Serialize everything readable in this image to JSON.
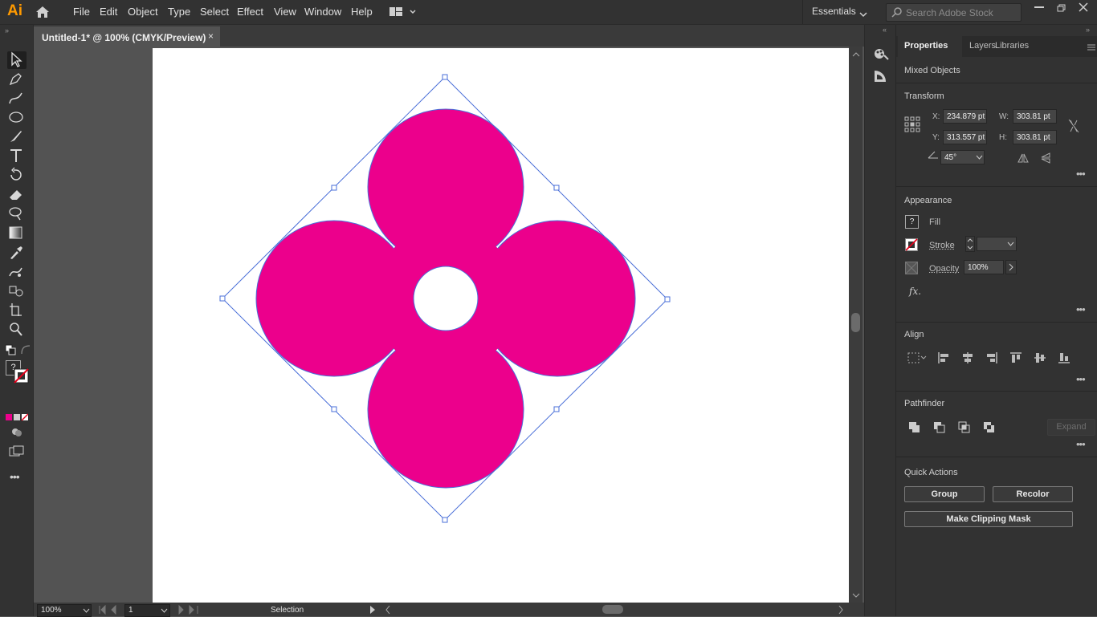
{
  "app": {
    "logo": "Ai"
  },
  "menu": [
    "File",
    "Edit",
    "Object",
    "Type",
    "Select",
    "Effect",
    "View",
    "Window",
    "Help"
  ],
  "workspace": {
    "label": "Essentials"
  },
  "search": {
    "placeholder": "Search Adobe Stock"
  },
  "document": {
    "tab_title": "Untitled-1* @ 100% (CMYK/Preview)",
    "close": "×"
  },
  "status": {
    "zoom": "100%",
    "artboard": "1",
    "tool": "Selection"
  },
  "panel": {
    "tabs": [
      "Properties",
      "Layers",
      "Libraries"
    ],
    "selection_type": "Mixed Objects",
    "transform": {
      "title": "Transform",
      "x_label": "X:",
      "x": "234.879 pt",
      "y_label": "Y:",
      "y": "313.557 pt",
      "w_label": "W:",
      "w": "303.81 pt",
      "h_label": "H:",
      "h": "303.81 pt",
      "angle": "45°"
    },
    "appearance": {
      "title": "Appearance",
      "fill_label": "Fill",
      "stroke_label": "Stroke",
      "opacity_label": "Opacity",
      "opacity": "100%",
      "fx": "fx."
    },
    "align": {
      "title": "Align"
    },
    "pathfinder": {
      "title": "Pathfinder",
      "expand": "Expand"
    },
    "quick_actions": {
      "title": "Quick Actions",
      "group": "Group",
      "recolor": "Recolor",
      "clip": "Make Clipping Mask"
    }
  },
  "colors": {
    "fill": "#ec008c",
    "selection": "#4a6fd8",
    "accent": "#ff9a00"
  }
}
